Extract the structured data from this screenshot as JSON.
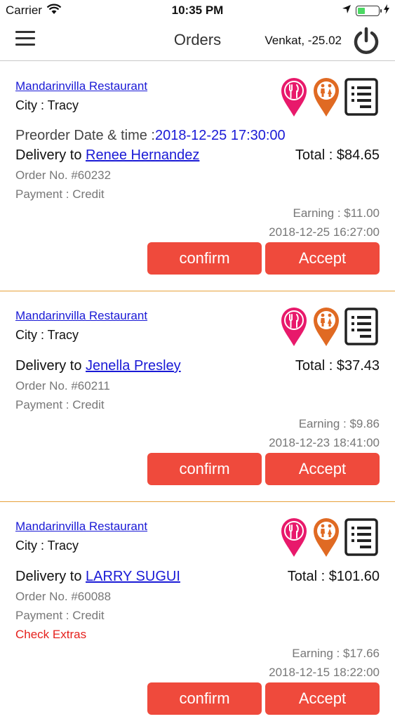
{
  "status_bar": {
    "carrier": "Carrier",
    "time": "10:35 PM"
  },
  "navbar": {
    "title": "Orders",
    "user": "Venkat, -25.02",
    "menu_icon": "hamburger-icon",
    "power_icon": "power-icon"
  },
  "colors": {
    "accent_button": "#ef4a3c",
    "link_blue": "#1a1ad6",
    "divider": "#e7a13a",
    "pink_pin": "#e8196b",
    "orange_pin": "#e06a23",
    "extras_red": "#e5201c"
  },
  "orders": [
    {
      "restaurant": "Mandarinvilla Restaurant",
      "city": "City : Tracy",
      "preorder_label": "Preorder Date & time :",
      "preorder_value": "2018-12-25 17:30:00",
      "delivery_prefix": "Delivery to ",
      "customer": "Renee Hernandez",
      "total": "Total : $84.65",
      "order_no": "Order No. #60232",
      "payment": "Payment : Credit",
      "earning": "Earning : $11.00",
      "datetime": "2018-12-25 16:27:00",
      "confirm_label": "confirm",
      "accept_label": "Accept"
    },
    {
      "restaurant": "Mandarinvilla Restaurant",
      "city": "City : Tracy",
      "delivery_prefix": "Delivery to ",
      "customer": "Jenella Presley",
      "total": "Total : $37.43",
      "order_no": "Order No. #60211",
      "payment": "Payment : Credit",
      "earning": "Earning : $9.86",
      "datetime": "2018-12-23 18:41:00",
      "confirm_label": "confirm",
      "accept_label": "Accept"
    },
    {
      "restaurant": "Mandarinvilla Restaurant",
      "city": "City : Tracy",
      "delivery_prefix": "Delivery to ",
      "customer": "LARRY SUGUI",
      "total": "Total : $101.60",
      "order_no": "Order No. #60088",
      "payment": "Payment : Credit",
      "extras": "Check Extras",
      "earning": "Earning : $17.66",
      "datetime": "2018-12-15 18:22:00",
      "confirm_label": "confirm",
      "accept_label": "Accept"
    }
  ]
}
